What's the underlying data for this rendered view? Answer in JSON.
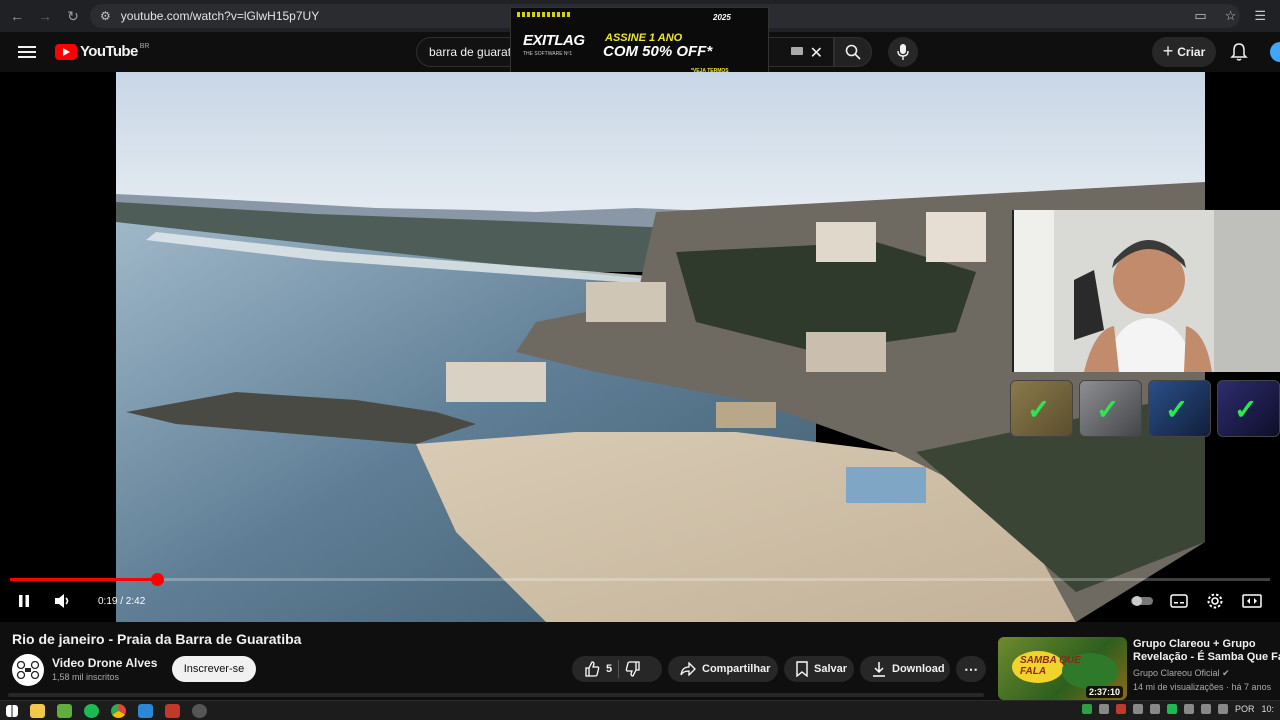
{
  "browser": {
    "url": "youtube.com/watch?v=lGlwH15p7UY"
  },
  "header": {
    "logo_text": "YouTube",
    "country_code": "BR",
    "search_value": "barra de guarat",
    "create_label": "Criar"
  },
  "ad": {
    "brand": "EXITLAG",
    "brand_sub": "THE SOFTWARE Nº1",
    "line1": "ASSINE 1 ANO",
    "line2": "COM 50% OFF*",
    "fine_print": "*VEJA TERMOS",
    "year_badge": "2025"
  },
  "player": {
    "time_current": "0:19",
    "time_total": "2:42",
    "time_display": "0:19 / 2:42",
    "progress_fraction": 0.117,
    "state": "playing"
  },
  "video": {
    "title": "Rio de janeiro - Praia da Barra de Guaratiba",
    "channel_name": "Video Drone Alves",
    "subscribers": "1,58 mil inscritos",
    "subscribe_label": "Inscrever-se",
    "likes": "5",
    "share_label": "Compartilhar",
    "save_label": "Salvar",
    "download_label": "Download"
  },
  "recommendation": {
    "title_line1": "Grupo Clareou + Grupo",
    "title_line2": "Revelação - É Samba Que Fala",
    "channel": "Grupo Clareou Oficial",
    "meta": "14 mi de visualizações · há 7 anos",
    "duration": "2:37:10",
    "thumb_text": "SAMBA QUE FALA"
  },
  "taskbar": {
    "lang": "POR",
    "clock": "10:"
  },
  "colors": {
    "accent_red": "#ff0000",
    "bg": "#0f0f0f",
    "check_green": "#2ee64e",
    "ad_yellow": "#f0e52a"
  }
}
